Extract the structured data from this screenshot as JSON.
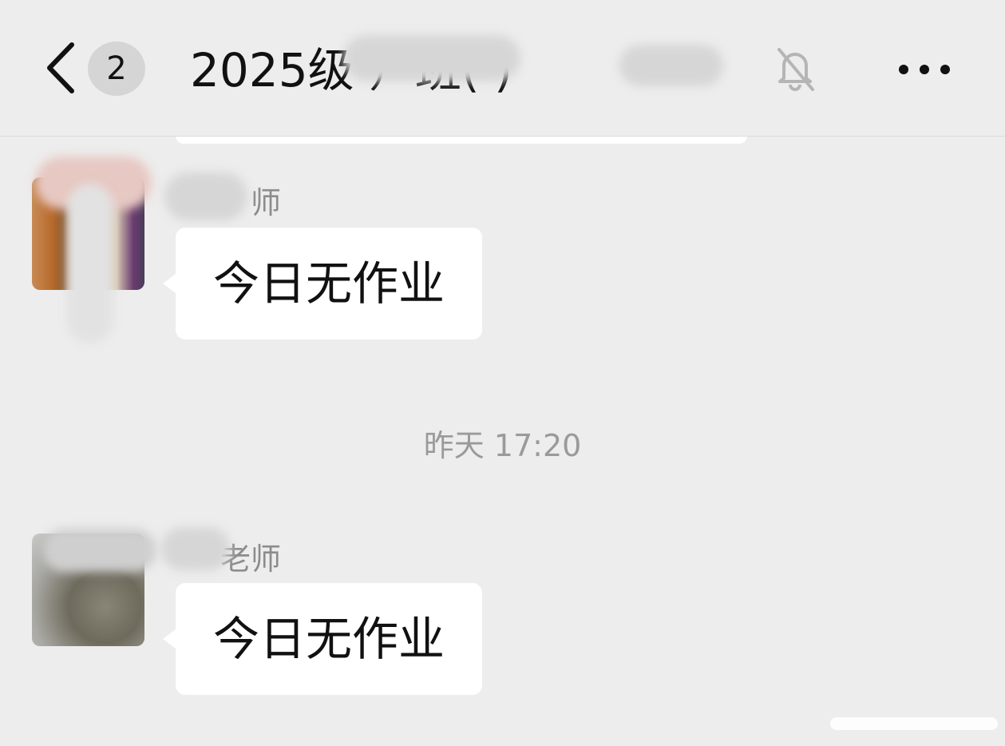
{
  "header": {
    "unread_count": "2",
    "title": "2025级      ）班(      )",
    "mute_icon": "bell-off-icon",
    "more_icon": "more-icon",
    "back_icon": "chevron-left-icon"
  },
  "messages": [
    {
      "sender": "师",
      "text": "今日无作业"
    },
    {
      "sender": "老师",
      "text": "今日无作业"
    }
  ],
  "time_divider": "昨天 17:20"
}
